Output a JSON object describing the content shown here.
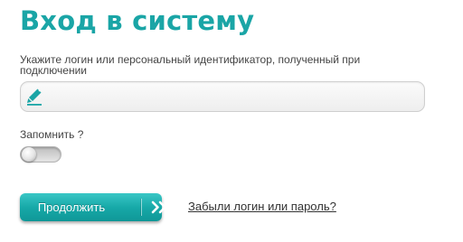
{
  "page_title": "Вход в систему",
  "login_hint": "Укажите логин или персональный идентификатор, полученный при подключении",
  "login_field": {
    "value": "",
    "icon": "pencil-icon"
  },
  "remember": {
    "label": "Запомнить ?",
    "checked": false
  },
  "submit": {
    "label": "Продолжить",
    "icon": "double-chevron-right-icon"
  },
  "forgot_link": "Забыли логин или пароль?",
  "colors": {
    "accent": "#1aa5a6",
    "button_top": "#39c7c6",
    "button_bottom": "#0f9797",
    "text": "#444444"
  }
}
